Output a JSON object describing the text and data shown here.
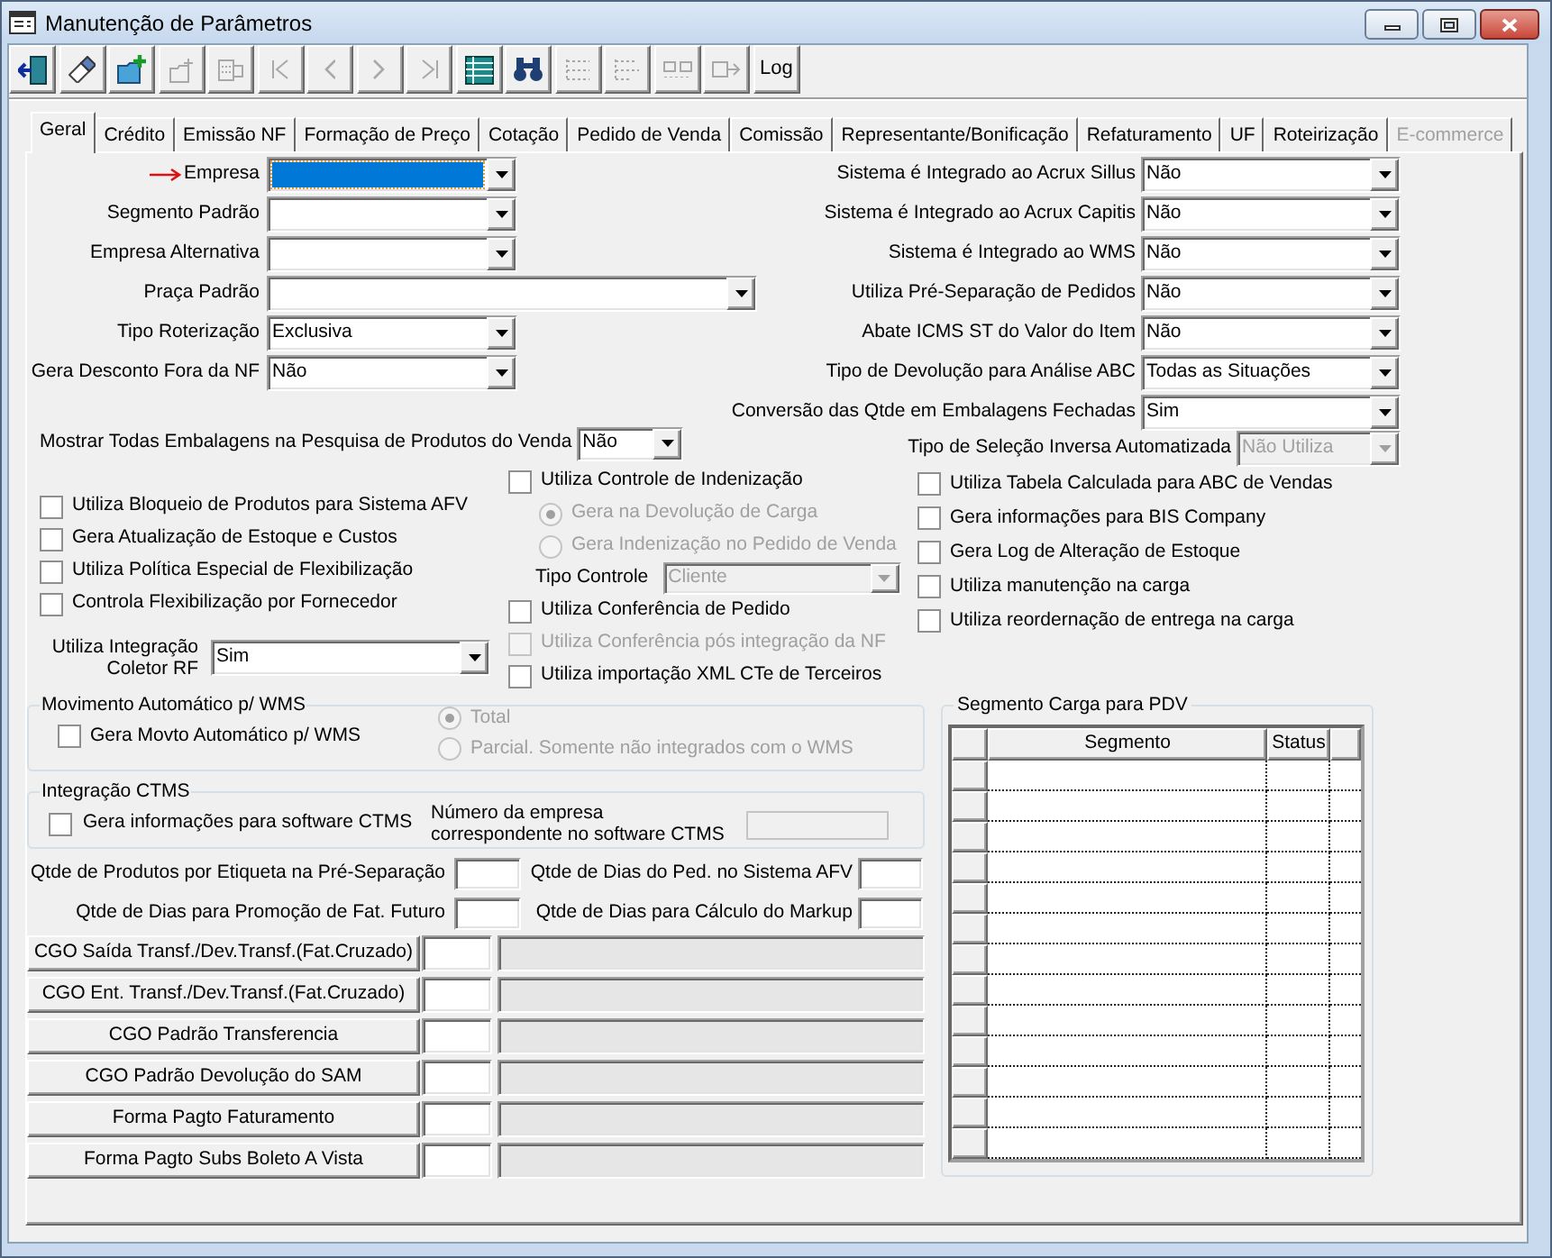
{
  "window": {
    "title": "Manutenção de Parâmetros"
  },
  "toolbar": [
    {
      "kind": "icon",
      "disabled": false
    },
    {
      "kind": "icon",
      "disabled": false
    },
    {
      "kind": "icon",
      "disabled": false
    },
    {
      "kind": "icon",
      "disabled": true
    },
    {
      "kind": "icon",
      "disabled": true
    },
    {
      "kind": "icon",
      "disabled": true
    },
    {
      "kind": "icon",
      "disabled": true
    },
    {
      "kind": "icon",
      "disabled": true
    },
    {
      "kind": "icon",
      "disabled": true
    },
    {
      "kind": "icon",
      "disabled": false
    },
    {
      "kind": "icon",
      "disabled": false
    },
    {
      "kind": "icon",
      "disabled": true
    },
    {
      "kind": "icon",
      "disabled": true
    },
    {
      "kind": "icon",
      "disabled": true
    },
    {
      "kind": "icon",
      "disabled": true
    },
    {
      "kind": "text",
      "label": "Log",
      "disabled": false
    }
  ],
  "tabs": [
    {
      "label": "Geral",
      "selected": true,
      "disabled": false
    },
    {
      "label": "Crédito",
      "selected": false,
      "disabled": false
    },
    {
      "label": "Emissão NF",
      "selected": false,
      "disabled": false
    },
    {
      "label": "Formação de Preço",
      "selected": false,
      "disabled": false
    },
    {
      "label": "Cotação",
      "selected": false,
      "disabled": false
    },
    {
      "label": "Pedido de Venda",
      "selected": false,
      "disabled": false
    },
    {
      "label": "Comissão",
      "selected": false,
      "disabled": false
    },
    {
      "label": "Representante/Bonificação",
      "selected": false,
      "disabled": false
    },
    {
      "label": "Refaturamento",
      "selected": false,
      "disabled": false
    },
    {
      "label": "UF",
      "selected": false,
      "disabled": false
    },
    {
      "label": "Roteirização",
      "selected": false,
      "disabled": false
    },
    {
      "label": "E-commerce",
      "selected": false,
      "disabled": true
    }
  ],
  "left_fields": [
    {
      "label": "Empresa",
      "marked": true,
      "focused": true
    },
    {
      "label": "Segmento Padrão",
      "marked": false,
      "focused": false
    },
    {
      "label": "Empresa Alternativa",
      "marked": false,
      "focused": false
    },
    {
      "label": "Praça Padrão",
      "marked": false,
      "focused": false
    },
    {
      "label": "Tipo Roterização",
      "value": "Exclusiva",
      "marked": false,
      "focused": false
    },
    {
      "label": "Gera Desconto Fora da NF",
      "value": "Não",
      "marked": false,
      "focused": false
    }
  ],
  "right_fields": [
    {
      "label": "Sistema é Integrado ao Acrux Sillus",
      "value": "Não",
      "disabled": false
    },
    {
      "label": "Sistema é Integrado ao Acrux Capitis",
      "value": "Não",
      "disabled": false
    },
    {
      "label": "Sistema é Integrado ao WMS",
      "value": "Não",
      "disabled": false
    },
    {
      "label": "Utiliza Pré-Separação de Pedidos",
      "value": "Não",
      "disabled": false
    },
    {
      "label": "Abate ICMS ST do Valor do Item",
      "value": "Não",
      "disabled": false
    },
    {
      "label": "Tipo de Devolução para Análise ABC",
      "value": "Todas as Situações",
      "disabled": false
    },
    {
      "label": "Conversão das Qtde em Embalagens Fechadas",
      "value": "Sim",
      "disabled": false
    },
    {
      "label": "Tipo de Seleção Inversa Automatizada",
      "value": "Não Utiliza",
      "disabled": true
    }
  ],
  "package_search": {
    "label": "Mostrar Todas Embalagens na Pesquisa de Produtos do Venda",
    "value": "Não"
  },
  "left_options": [
    {
      "kind": "checkbox",
      "label": "Utiliza Bloqueio de Produtos para Sistema AFV",
      "checked": false
    },
    {
      "kind": "checkbox",
      "label": "Gera Atualização de Estoque e Custos",
      "checked": false
    },
    {
      "kind": "checkbox",
      "label": "Utiliza Política Especial de Flexibilização",
      "checked": false
    },
    {
      "kind": "checkbox",
      "label": "Controla Flexibilização por Fornecedor",
      "checked": false
    },
    {
      "kind": "select",
      "label": "Utiliza Integração Coletor RF",
      "value": "Sim"
    }
  ],
  "middle_options": [
    {
      "kind": "checkbox",
      "label": "Utiliza Controle de Indenização",
      "checked": false,
      "disabled": false
    },
    {
      "kind": "radio",
      "label": "Gera na Devolução de Carga",
      "selected": true,
      "disabled": true
    },
    {
      "kind": "radio",
      "label": "Gera Indenização no Pedido de Venda",
      "selected": false,
      "disabled": true
    },
    {
      "kind": "select",
      "label": "Tipo Controle",
      "value": "Cliente",
      "disabled": true
    },
    {
      "kind": "checkbox",
      "label": "Utiliza Conferência de Pedido",
      "checked": false,
      "disabled": false
    },
    {
      "kind": "checkbox",
      "label": "Utiliza Conferência pós integração da NF",
      "checked": false,
      "disabled": true
    },
    {
      "kind": "checkbox",
      "label": "Utiliza importação XML CTe de Terceiros",
      "checked": false,
      "disabled": false
    }
  ],
  "right_options": [
    {
      "label": "Utiliza Tabela Calculada para ABC de Vendas",
      "checked": false
    },
    {
      "label": "Gera informações para BIS Company",
      "checked": false
    },
    {
      "label": "Gera Log de Alteração de Estoque",
      "checked": false
    },
    {
      "label": "Utiliza manutenção na carga",
      "checked": false
    },
    {
      "label": "Utiliza reordernação de entrega na carga",
      "checked": false
    }
  ],
  "wms_group": {
    "title": "Movimento Automático p/ WMS",
    "checkbox": {
      "label": "Gera Movto Automático p/ WMS",
      "checked": false
    },
    "options": [
      {
        "label": "Total",
        "selected": true,
        "disabled": true
      },
      {
        "label": "Parcial. Somente não integrados com o WMS",
        "selected": false,
        "disabled": true
      }
    ]
  },
  "ctms_group": {
    "title": "Integração CTMS",
    "checkbox": {
      "label": "Gera informações para software CTMS",
      "checked": false
    },
    "company_number": {
      "label": "Número da empresa\ncorrespondente no software CTMS",
      "disabled": true
    }
  },
  "quantity_fields": [
    {
      "label": "Qtde de Produtos por Etiqueta na Pré-Separação"
    },
    {
      "label": "Qtde de Dias do Ped. no Sistema AFV"
    },
    {
      "label": "Qtde de Dias para Promoção de Fat. Futuro"
    },
    {
      "label": "Qtde de Dias para Cálculo do Markup"
    }
  ],
  "lookups": [
    {
      "button": "CGO Saída Transf./Dev.Transf.(Fat.Cruzado)",
      "description_disabled": true
    },
    {
      "button": "CGO Ent. Transf./Dev.Transf.(Fat.Cruzado)",
      "description_disabled": true
    },
    {
      "button": "CGO Padrão Transferencia",
      "description_disabled": true
    },
    {
      "button": "CGO Padrão Devolução do SAM",
      "description_disabled": true
    },
    {
      "button": "Forma Pagto Faturamento",
      "description_disabled": true
    },
    {
      "button": "Forma Pagto Subs Boleto A Vista",
      "description_disabled": true
    }
  ],
  "segment_grid": {
    "title": "Segmento Carga para PDV",
    "columns": [
      "Segmento",
      "Status"
    ]
  }
}
